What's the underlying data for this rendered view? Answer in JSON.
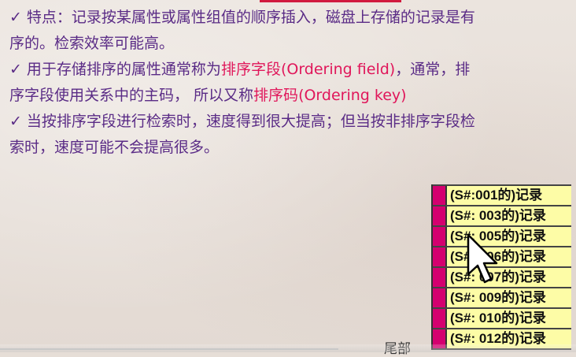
{
  "bullets": [
    {
      "check": "✓",
      "parts": [
        {
          "text": "特点：记录按某属性或属性组值的顺序插入，磁盘上存储的记录是有"
        }
      ]
    },
    {
      "check": "",
      "parts": [
        {
          "text": "序的。检索效率可能高。"
        }
      ]
    },
    {
      "check": "✓",
      "parts": [
        {
          "text": "用于存储排序的属性通常称为"
        },
        {
          "text": "排序字段",
          "hl": true
        },
        {
          "text": "(Ordering field)",
          "hl": true
        },
        {
          "text": "，通常，排"
        }
      ]
    },
    {
      "check": "",
      "parts": [
        {
          "text": "序字段使用关系中的主码， 所以又称"
        },
        {
          "text": "排序码",
          "hl": true
        },
        {
          "text": "(Ordering key)",
          "hl": true
        }
      ]
    },
    {
      "check": "✓",
      "parts": [
        {
          "text": "当按排序字段进行检索时，速度得到很大提高；但当按非排序字段检"
        }
      ]
    },
    {
      "check": "",
      "parts": [
        {
          "text": "索时，速度可能不会提高很多。"
        }
      ]
    }
  ],
  "records": [
    "(S#:001的)记录",
    "(S#: 003的)记录",
    "(S#: 005的)记录",
    "(S#: 006的)记录",
    "(S#: 007的)记录",
    "(S#: 009的)记录",
    "(S#: 010的)记录",
    "(S#: 012的)记录"
  ],
  "tail_label": "尾部",
  "colors": {
    "text": "#5a2b86",
    "highlight": "#e0165a",
    "record_bg": "#fdfca6",
    "stripe": "#d4006f"
  },
  "icons": {
    "cursor": "mouse-pointer-icon",
    "check": "checkmark-icon"
  }
}
